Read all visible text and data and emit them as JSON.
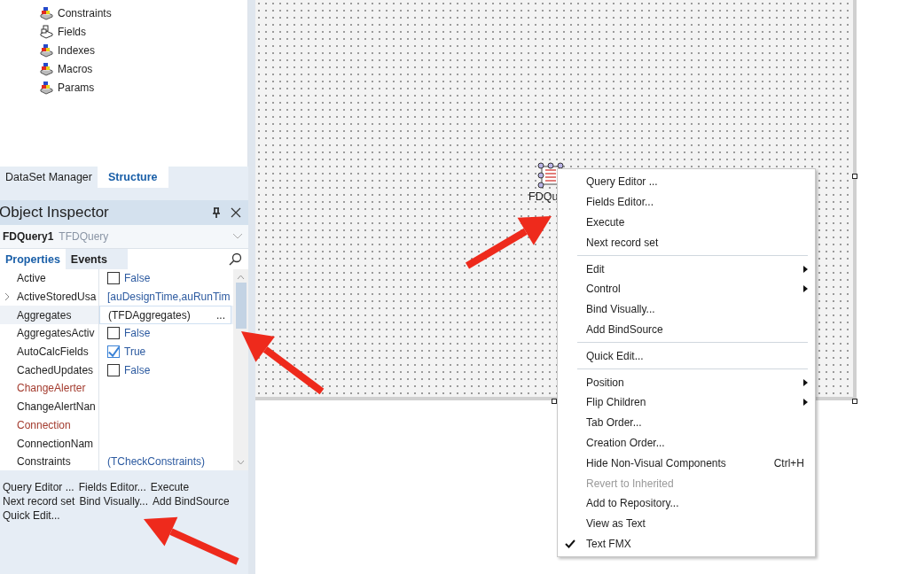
{
  "structure_tree": {
    "items": [
      {
        "label": "Constraints",
        "kind": "colored"
      },
      {
        "label": "Fields",
        "kind": "plain"
      },
      {
        "label": "Indexes",
        "kind": "colored"
      },
      {
        "label": "Macros",
        "kind": "colored"
      },
      {
        "label": "Params",
        "kind": "colored"
      }
    ]
  },
  "panel_tabs": [
    {
      "label": "DataSet Manager",
      "selected": false
    },
    {
      "label": "Structure",
      "selected": true
    }
  ],
  "object_inspector": {
    "title": "Object Inspector",
    "component_name": "FDQuery1",
    "component_type": "TFDQuery",
    "tabs": [
      {
        "label": "Properties",
        "selected": true
      },
      {
        "label": "Events",
        "selected": false
      }
    ],
    "properties": [
      {
        "name": "Active",
        "reference": false,
        "expandable": false,
        "selected": false,
        "value": {
          "kind": "checkbox",
          "checked": false,
          "text": "False",
          "highlighted": true
        }
      },
      {
        "name": "ActiveStoredUsa",
        "reference": false,
        "expandable": true,
        "selected": false,
        "value": {
          "kind": "text",
          "text": "[auDesignTime,auRunTim",
          "highlighted": true
        }
      },
      {
        "name": "Aggregates",
        "reference": false,
        "expandable": false,
        "selected": true,
        "value": {
          "kind": "ellipsis",
          "text": "(TFDAggregates)",
          "button": "...",
          "highlighted": false
        }
      },
      {
        "name": "AggregatesActiv",
        "reference": false,
        "expandable": false,
        "selected": false,
        "value": {
          "kind": "checkbox",
          "checked": false,
          "text": "False",
          "highlighted": true
        }
      },
      {
        "name": "AutoCalcFields",
        "reference": false,
        "expandable": false,
        "selected": false,
        "value": {
          "kind": "checkbox",
          "checked": true,
          "text": "True",
          "highlighted": true
        }
      },
      {
        "name": "CachedUpdates",
        "reference": false,
        "expandable": false,
        "selected": false,
        "value": {
          "kind": "checkbox",
          "checked": false,
          "text": "False",
          "highlighted": true
        }
      },
      {
        "name": "ChangeAlerter",
        "reference": true,
        "expandable": false,
        "selected": false,
        "value": {
          "kind": "empty"
        }
      },
      {
        "name": "ChangeAlertNan",
        "reference": false,
        "expandable": false,
        "selected": false,
        "value": {
          "kind": "empty"
        }
      },
      {
        "name": "Connection",
        "reference": true,
        "expandable": false,
        "selected": false,
        "value": {
          "kind": "empty"
        }
      },
      {
        "name": "ConnectionNam",
        "reference": false,
        "expandable": false,
        "selected": false,
        "value": {
          "kind": "empty"
        }
      },
      {
        "name": "Constraints",
        "reference": false,
        "expandable": false,
        "selected": false,
        "value": {
          "kind": "text",
          "text": "(TCheckConstraints)",
          "highlighted": true
        }
      }
    ],
    "verbs": [
      "Query Editor ...",
      "Fields Editor...",
      "Execute",
      "Next record set",
      "Bind Visually...",
      "Add BindSource",
      "Quick Edit..."
    ]
  },
  "form_designer": {
    "component_label": "FDQu"
  },
  "context_menu": [
    {
      "kind": "item",
      "label": "Query Editor ...",
      "submenu": false,
      "checked": false,
      "disabled": false
    },
    {
      "kind": "item",
      "label": "Fields Editor...",
      "submenu": false,
      "checked": false,
      "disabled": false
    },
    {
      "kind": "item",
      "label": "Execute",
      "submenu": false,
      "checked": false,
      "disabled": false
    },
    {
      "kind": "item",
      "label": "Next record set",
      "submenu": false,
      "checked": false,
      "disabled": false
    },
    {
      "kind": "separator"
    },
    {
      "kind": "item",
      "label": "Edit",
      "submenu": true,
      "checked": false,
      "disabled": false
    },
    {
      "kind": "item",
      "label": "Control",
      "submenu": true,
      "checked": false,
      "disabled": false
    },
    {
      "kind": "item",
      "label": "Bind Visually...",
      "submenu": false,
      "checked": false,
      "disabled": false
    },
    {
      "kind": "item",
      "label": "Add BindSource",
      "submenu": false,
      "checked": false,
      "disabled": false
    },
    {
      "kind": "separator"
    },
    {
      "kind": "item",
      "label": "Quick Edit...",
      "submenu": false,
      "checked": false,
      "disabled": false
    },
    {
      "kind": "separator"
    },
    {
      "kind": "item",
      "label": "Position",
      "submenu": true,
      "checked": false,
      "disabled": false
    },
    {
      "kind": "item",
      "label": "Flip Children",
      "submenu": true,
      "checked": false,
      "disabled": false
    },
    {
      "kind": "item",
      "label": "Tab Order...",
      "submenu": false,
      "checked": false,
      "disabled": false
    },
    {
      "kind": "item",
      "label": "Creation Order...",
      "submenu": false,
      "checked": false,
      "disabled": false
    },
    {
      "kind": "item",
      "label": "Hide Non-Visual Components",
      "shortcut": "Ctrl+H",
      "submenu": false,
      "checked": false,
      "disabled": false
    },
    {
      "kind": "item",
      "label": "Revert to Inherited",
      "submenu": false,
      "checked": false,
      "disabled": true
    },
    {
      "kind": "item",
      "label": "Add to Repository...",
      "submenu": false,
      "checked": false,
      "disabled": false
    },
    {
      "kind": "item",
      "label": "View as Text",
      "submenu": false,
      "checked": false,
      "disabled": false
    },
    {
      "kind": "item",
      "label": "Text FMX",
      "submenu": false,
      "checked": true,
      "disabled": false
    }
  ]
}
